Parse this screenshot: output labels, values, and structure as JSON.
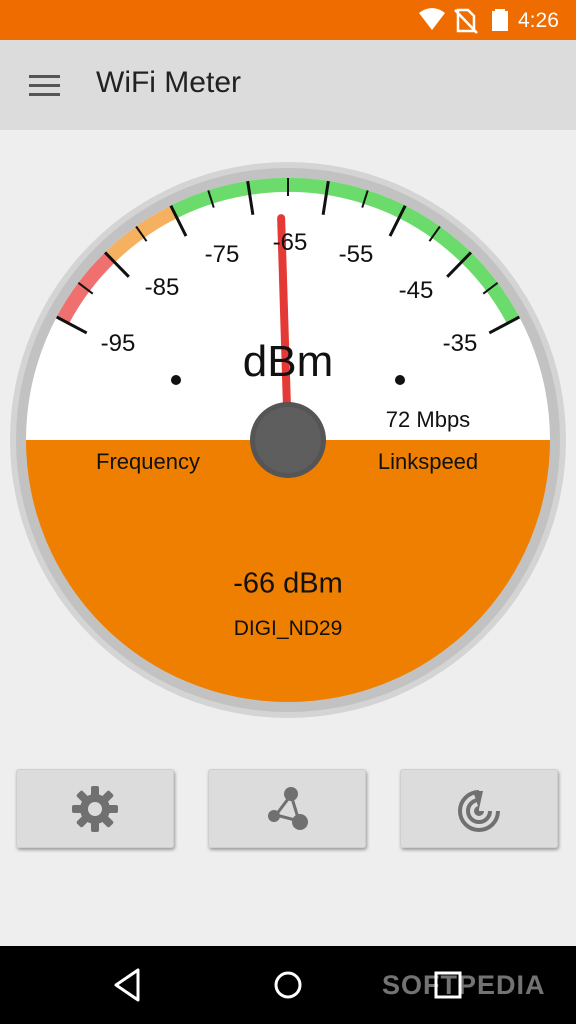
{
  "status_bar": {
    "time": "4:26",
    "icons": [
      "wifi-icon",
      "no-sim-icon",
      "battery-icon"
    ],
    "color": "#ef6c00"
  },
  "app_bar": {
    "title": "WiFi Meter",
    "menu_icon": "hamburger-menu-icon"
  },
  "gauge": {
    "unit": "dBm",
    "scale_ticks": [
      "-95",
      "-85",
      "-75",
      "-65",
      "-55",
      "-45",
      "-35"
    ],
    "needle_value_dbm": -66,
    "frequency_label": "Frequency",
    "linkspeed_label": "Linkspeed",
    "linkspeed_value": "72 Mbps",
    "reading": "-66 dBm",
    "network_name": "DIGI_ND29",
    "colors": {
      "bad_zone": "#f07070",
      "fair_zone": "#f5b060",
      "good_zone": "#6bdc6b",
      "lower_face": "#ef7f00",
      "needle": "#e53935"
    }
  },
  "toolbar": {
    "buttons": [
      {
        "icon": "gear-icon"
      },
      {
        "icon": "network-nodes-icon"
      },
      {
        "icon": "radar-icon"
      }
    ]
  },
  "nav_bar": {
    "buttons": [
      "back-icon",
      "home-icon",
      "recents-icon"
    ],
    "watermark": "SOFTPEDIA"
  }
}
